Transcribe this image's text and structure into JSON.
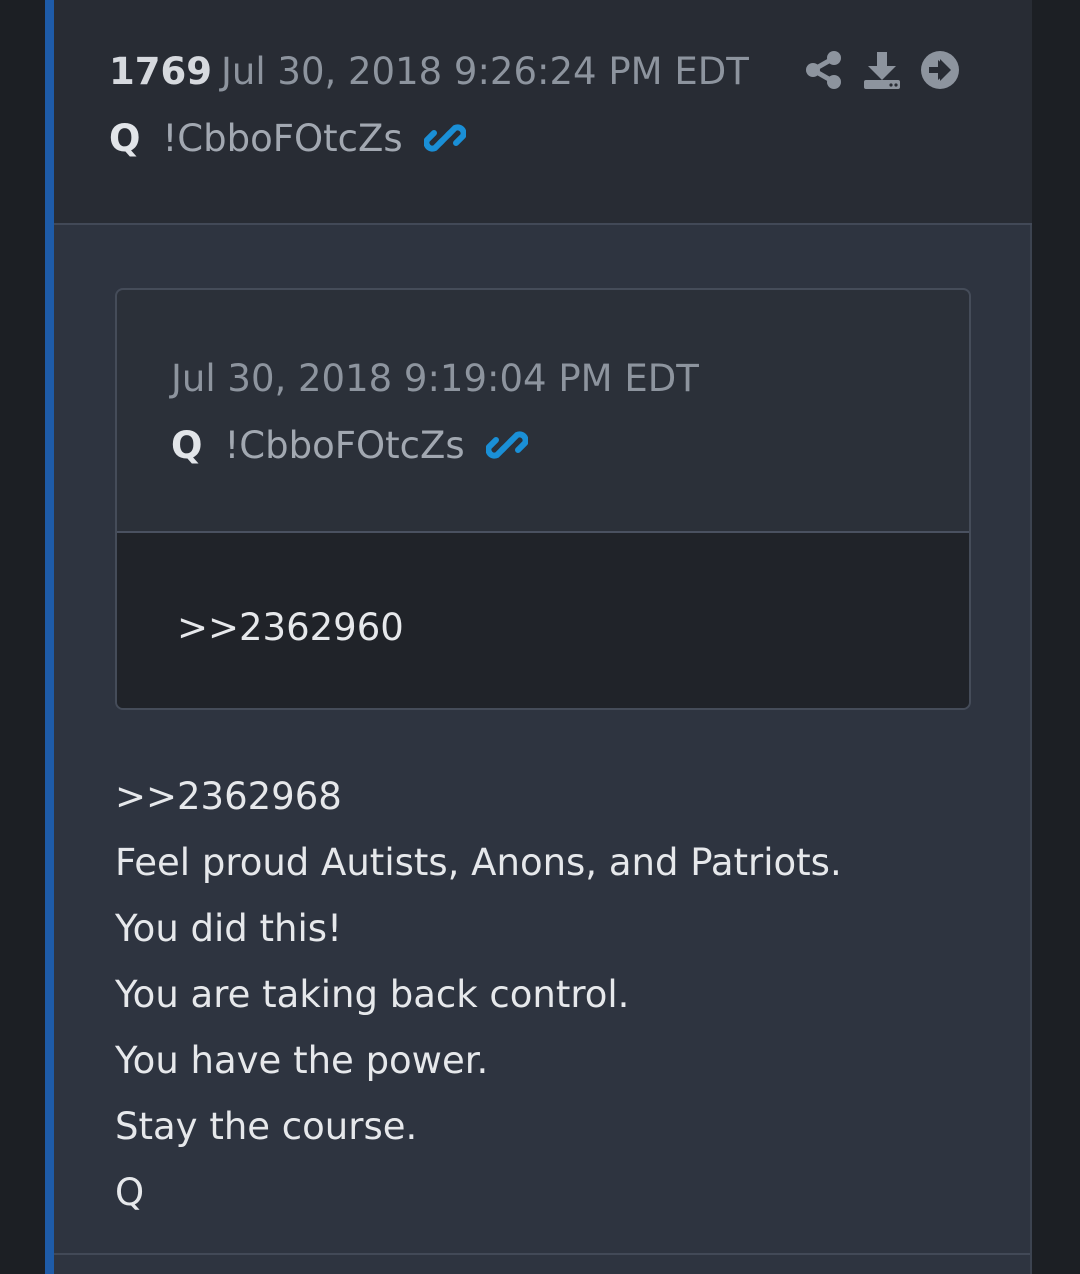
{
  "post": {
    "number": "1769",
    "timestamp": "Jul 30, 2018 9:26:24 PM EDT",
    "author": "Q",
    "tripcode": "!CbboFOtcZs",
    "actions": [
      "share-icon",
      "download-icon",
      "go-to-icon"
    ]
  },
  "quoted": {
    "timestamp": "Jul 30, 2018 9:19:04 PM EDT",
    "author": "Q",
    "tripcode": "!CbboFOtcZs",
    "body": ">>2362960"
  },
  "body": {
    "lines": [
      ">>2362968",
      "Feel proud Autists, Anons, and Patriots.",
      "You did this!",
      "You are taking back control.",
      "You have the power.",
      "Stay the course.",
      "Q"
    ]
  },
  "colors": {
    "accent": "#1e5ba8",
    "link": "#1a8fd6"
  }
}
